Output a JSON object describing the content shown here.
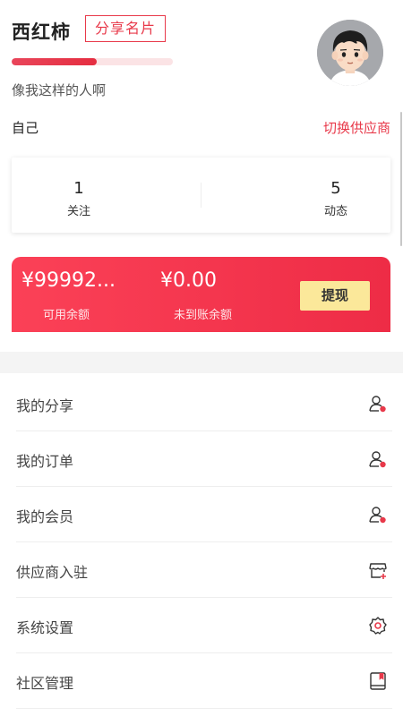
{
  "profile": {
    "name": "西红柿",
    "share_card_label": "分享名片",
    "level_progress": 0.53,
    "signature": "像我这样的人啊",
    "avatar_icon": "cartoon-boy-avatar"
  },
  "supplier": {
    "current": "自己",
    "switch_label": "切换供应商"
  },
  "stats": [
    {
      "value": "1",
      "label": "关注"
    },
    {
      "value": "5",
      "label": "动态"
    }
  ],
  "wallet": {
    "available_amount": "¥99992...",
    "available_label": "可用余额",
    "pending_amount": "¥0.00",
    "pending_label": "未到账余额",
    "withdraw_label": "提现",
    "accent": "#f43a50",
    "button_color": "#fbe89a"
  },
  "menu": [
    {
      "label": "我的分享",
      "icon": "user-share-icon"
    },
    {
      "label": "我的订单",
      "icon": "user-order-icon"
    },
    {
      "label": "我的会员",
      "icon": "user-member-icon"
    },
    {
      "label": "供应商入驻",
      "icon": "store-add-icon"
    },
    {
      "label": "系统设置",
      "icon": "gear-icon"
    },
    {
      "label": "社区管理",
      "icon": "book-icon"
    }
  ]
}
